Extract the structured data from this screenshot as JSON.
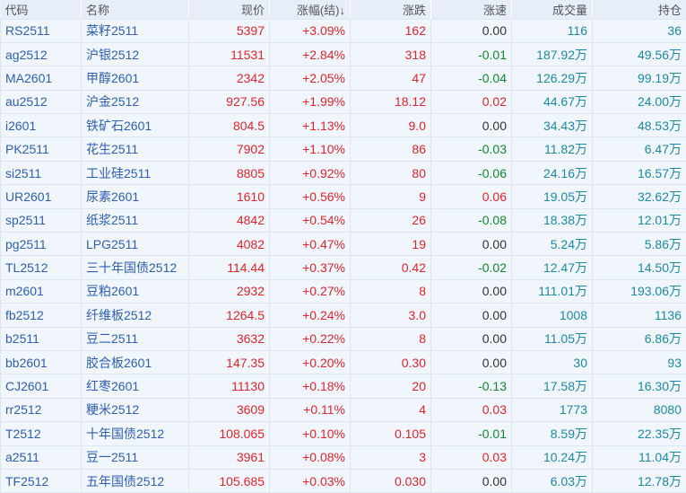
{
  "headers": [
    "代码",
    "名称",
    "现价",
    "涨幅(结)↓",
    "涨跌",
    "涨速",
    "成交量",
    "持仓"
  ],
  "colors": {
    "up": "#e3242b",
    "down": "#11882e",
    "flat": "#333333",
    "volume": "#1b8aa6",
    "link": "#2e5fb5"
  },
  "rows": [
    [
      "RS2511",
      "菜籽2511",
      "5397",
      "+3.09%",
      "162",
      "0.00",
      "116",
      "36"
    ],
    [
      "ag2512",
      "沪银2512",
      "11531",
      "+2.84%",
      "318",
      "-0.01",
      "187.92万",
      "49.56万"
    ],
    [
      "MA2601",
      "甲醇2601",
      "2342",
      "+2.05%",
      "47",
      "-0.04",
      "126.29万",
      "99.19万"
    ],
    [
      "au2512",
      "沪金2512",
      "927.56",
      "+1.99%",
      "18.12",
      "0.02",
      "44.67万",
      "24.00万"
    ],
    [
      "i2601",
      "铁矿石2601",
      "804.5",
      "+1.13%",
      "9.0",
      "0.00",
      "34.43万",
      "48.53万"
    ],
    [
      "PK2511",
      "花生2511",
      "7902",
      "+1.10%",
      "86",
      "-0.03",
      "11.82万",
      "6.47万"
    ],
    [
      "si2511",
      "工业硅2511",
      "8805",
      "+0.92%",
      "80",
      "-0.06",
      "24.16万",
      "16.57万"
    ],
    [
      "UR2601",
      "尿素2601",
      "1610",
      "+0.56%",
      "9",
      "0.06",
      "19.05万",
      "32.62万"
    ],
    [
      "sp2511",
      "纸浆2511",
      "4842",
      "+0.54%",
      "26",
      "-0.08",
      "18.38万",
      "12.01万"
    ],
    [
      "pg2511",
      "LPG2511",
      "4082",
      "+0.47%",
      "19",
      "0.00",
      "5.24万",
      "5.86万"
    ],
    [
      "TL2512",
      "三十年国债2512",
      "114.44",
      "+0.37%",
      "0.42",
      "-0.02",
      "12.47万",
      "14.50万"
    ],
    [
      "m2601",
      "豆粕2601",
      "2932",
      "+0.27%",
      "8",
      "0.00",
      "111.01万",
      "193.06万"
    ],
    [
      "fb2512",
      "纤维板2512",
      "1264.5",
      "+0.24%",
      "3.0",
      "0.00",
      "1008",
      "1136"
    ],
    [
      "b2511",
      "豆二2511",
      "3632",
      "+0.22%",
      "8",
      "0.00",
      "11.05万",
      "6.86万"
    ],
    [
      "bb2601",
      "胶合板2601",
      "147.35",
      "+0.20%",
      "0.30",
      "0.00",
      "30",
      "93"
    ],
    [
      "CJ2601",
      "红枣2601",
      "11130",
      "+0.18%",
      "20",
      "-0.13",
      "17.58万",
      "16.30万"
    ],
    [
      "rr2512",
      "粳米2512",
      "3609",
      "+0.11%",
      "4",
      "0.03",
      "1773",
      "8080"
    ],
    [
      "T2512",
      "十年国债2512",
      "108.065",
      "+0.10%",
      "0.105",
      "-0.01",
      "8.59万",
      "22.35万"
    ],
    [
      "a2511",
      "豆一2511",
      "3961",
      "+0.08%",
      "3",
      "0.03",
      "10.24万",
      "11.04万"
    ],
    [
      "TF2512",
      "五年国债2512",
      "105.685",
      "+0.03%",
      "0.030",
      "0.00",
      "6.03万",
      "12.78万"
    ]
  ]
}
